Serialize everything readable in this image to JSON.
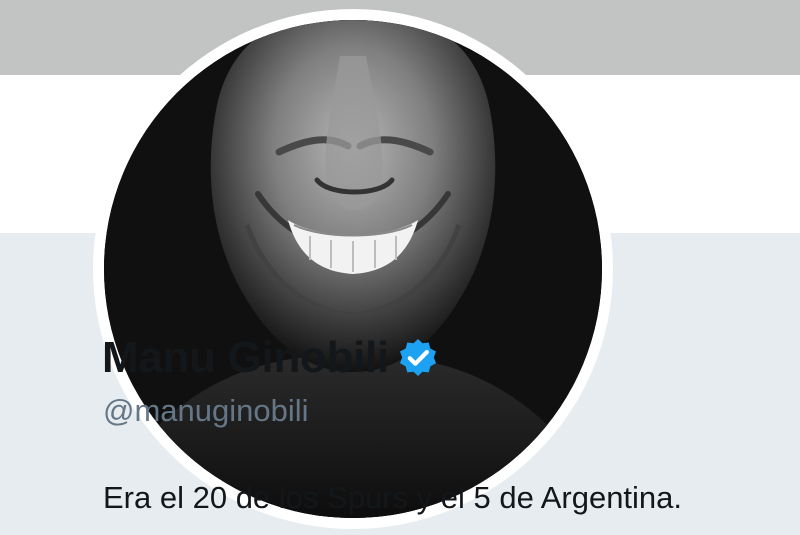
{
  "profile": {
    "display_name": "Manu Ginobili",
    "handle": "@manuginobili",
    "bio": "Era el 20 de los Spurs y el 5 de Argentina.",
    "verified": true,
    "verified_icon": "verified-badge-icon",
    "avatar_icon": "profile-photo"
  },
  "colors": {
    "banner": "#c2c4c4",
    "header_background": "#ffffff",
    "panel_background": "#e6ecf0",
    "name": "#14171a",
    "handle": "#657786",
    "verified_blue": "#1da1f2"
  }
}
